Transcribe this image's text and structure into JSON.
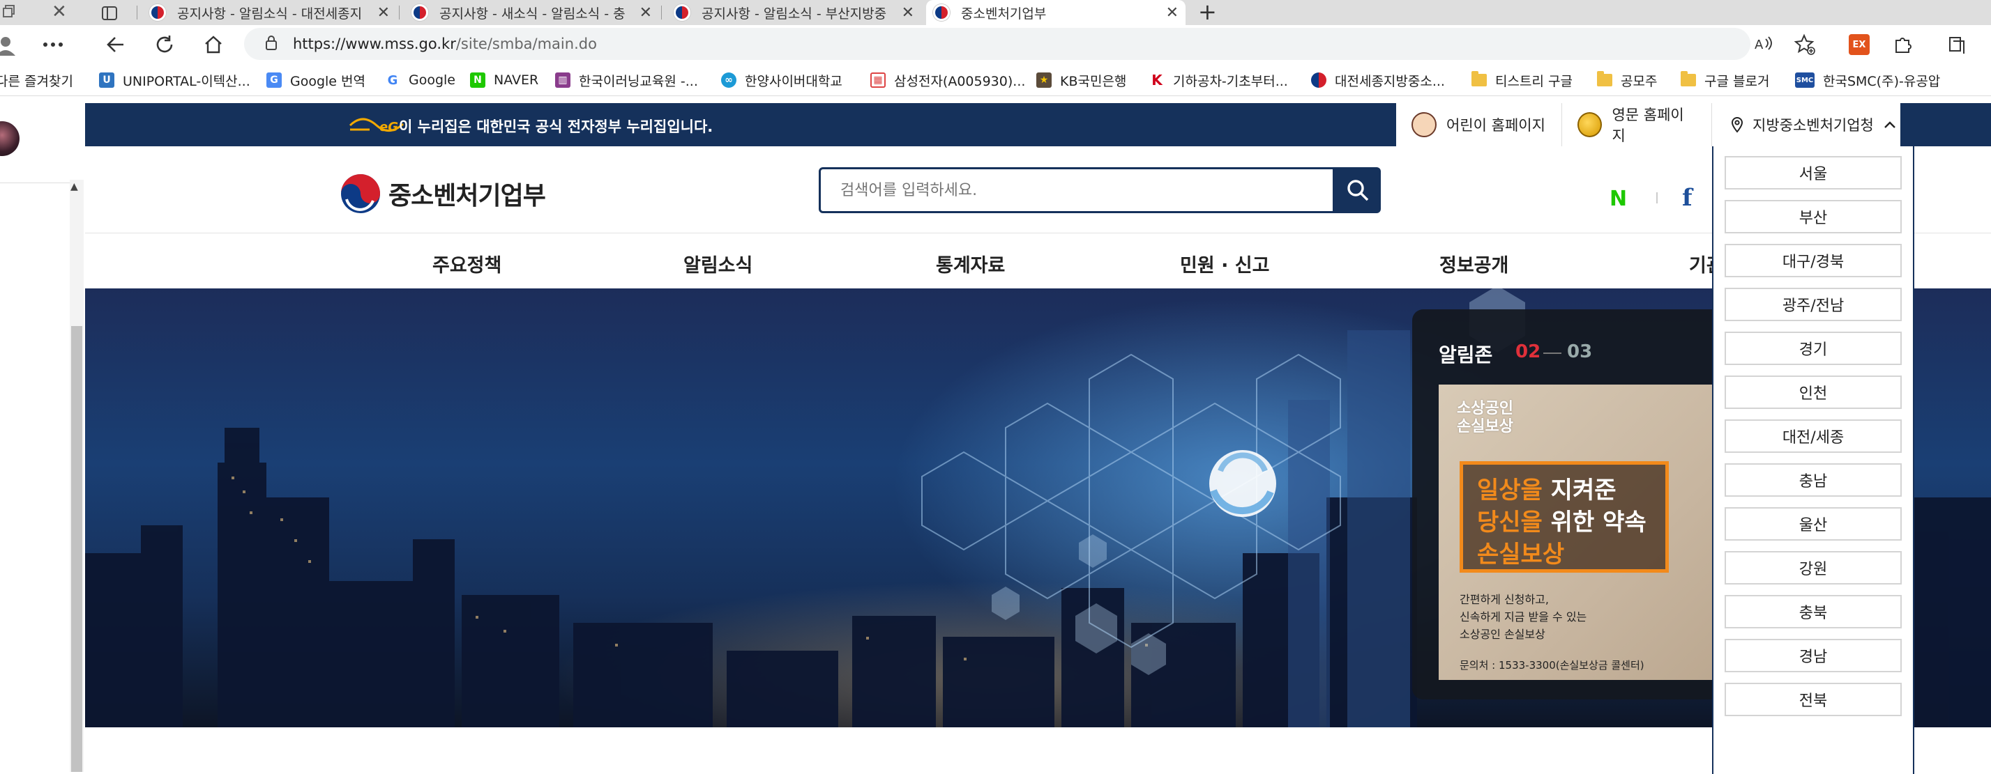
{
  "browser": {
    "tabs": [
      {
        "title": "공지사항 - 알림소식 - 대전세종지"
      },
      {
        "title": "공지사항 - 새소식 - 알림소식 - 충"
      },
      {
        "title": "공지사항 - 알림소식 - 부산지방중"
      },
      {
        "title": "중소벤처기업부"
      }
    ],
    "url_host": "https://www.mss.go.kr",
    "url_path": "/site/smba/main.do",
    "bookmarks": [
      {
        "label": "다른 즐겨찾기"
      },
      {
        "label": "UNIPORTAL-이텍산..."
      },
      {
        "label": "Google 번역"
      },
      {
        "label": "Google"
      },
      {
        "label": "NAVER"
      },
      {
        "label": "한국이러닝교육원 -..."
      },
      {
        "label": "한양사이버대학교"
      },
      {
        "label": "삼성전자(A005930)..."
      },
      {
        "label": "KB국민은행"
      },
      {
        "label": "기하공차-기초부터..."
      },
      {
        "label": "대전세종지방중소..."
      },
      {
        "label": "티스트리 구글"
      },
      {
        "label": "공모주"
      },
      {
        "label": "구글 블로거"
      },
      {
        "label": "한국SMC(주)-유공압"
      }
    ]
  },
  "site": {
    "gov_banner_text": "이 누리집은 대한민국 공식 전자정부 누리집입니다.",
    "kids_link": "어린이 홈페이지",
    "english_link": "영문 홈페이지",
    "regional_label": "지방중소벤처기업청",
    "logo_text": "중소벤처기업부",
    "search_placeholder": "검색어를 입력하세요.",
    "sns_naver": "N",
    "sns_facebook": "f",
    "nav": [
      "주요정책",
      "알림소식",
      "통계자료",
      "민원 · 신고",
      "정보공개",
      "기관"
    ],
    "notice": {
      "title": "알림존",
      "current": "02",
      "total": "03",
      "card_brand": [
        "소상공인",
        "손실보상"
      ],
      "card_line1": {
        "hl": "일상을",
        "rest": " 지켜준"
      },
      "card_line2": {
        "hl": "당신을",
        "rest": " 위한 약속"
      },
      "card_line3": "손실보상",
      "card_desc": [
        "간편하게 신청하고,",
        "신속하게 지금 받을 수 있는",
        "소상공인 손실보상"
      ],
      "card_contact": "문의처 : 1533-3300(손실보상금 콜센터)"
    },
    "regions": [
      "서울",
      "부산",
      "대구/경북",
      "광주/전남",
      "경기",
      "인천",
      "대전/세종",
      "충남",
      "울산",
      "강원",
      "충북",
      "경남",
      "전북"
    ]
  }
}
